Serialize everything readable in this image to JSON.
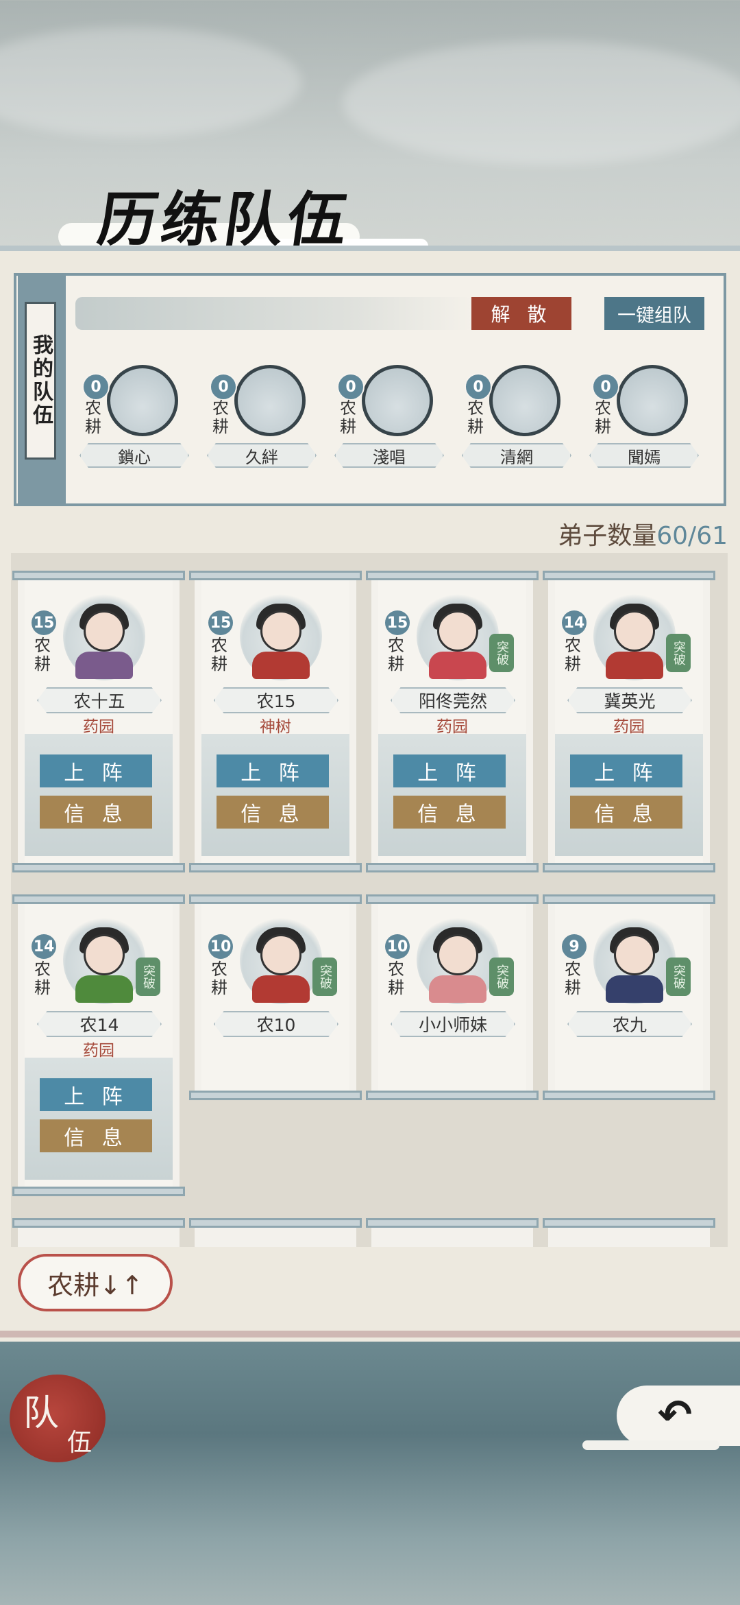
{
  "title": "历练队伍",
  "team": {
    "label": "我的队伍",
    "disband_label": "解 散",
    "auto_label": "一键组队",
    "members": [
      {
        "level": "0",
        "skill": "农耕",
        "name": "鎖心"
      },
      {
        "level": "0",
        "skill": "农耕",
        "name": "久絆"
      },
      {
        "level": "0",
        "skill": "农耕",
        "name": "淺唱"
      },
      {
        "level": "0",
        "skill": "农耕",
        "name": "清網"
      },
      {
        "level": "0",
        "skill": "农耕",
        "name": "聞嫣"
      }
    ]
  },
  "disciples": {
    "label": "弟子数量",
    "count": "60/61",
    "cards": [
      {
        "level": "15",
        "skill": "农耕",
        "name": "农十五",
        "location": "药园",
        "breakthrough": "",
        "up_label": "上 阵",
        "info_label": "信 息"
      },
      {
        "level": "15",
        "skill": "农耕",
        "name": "农15",
        "location": "神树",
        "breakthrough": "",
        "up_label": "上 阵",
        "info_label": "信 息"
      },
      {
        "level": "15",
        "skill": "农耕",
        "name": "阳佟莞然",
        "location": "药园",
        "breakthrough": "突破",
        "up_label": "上 阵",
        "info_label": "信 息"
      },
      {
        "level": "14",
        "skill": "农耕",
        "name": "冀英光",
        "location": "药园",
        "breakthrough": "突破",
        "up_label": "上 阵",
        "info_label": "信 息"
      },
      {
        "level": "14",
        "skill": "农耕",
        "name": "农14",
        "location": "药园",
        "breakthrough": "突破",
        "up_label": "上 阵",
        "info_label": "信 息"
      },
      {
        "level": "10",
        "skill": "农耕",
        "name": "农10",
        "location": "",
        "breakthrough": "突破"
      },
      {
        "level": "10",
        "skill": "农耕",
        "name": "小小师妹",
        "location": "",
        "breakthrough": "突破"
      },
      {
        "level": "9",
        "skill": "农耕",
        "name": "农九",
        "location": "",
        "breakthrough": "突破"
      }
    ]
  },
  "sort_label": "农耕↓↑",
  "nav": {
    "team_tab_char1": "队",
    "team_tab_char2": "伍",
    "back_icon": "back-arrow-icon"
  },
  "colors": {
    "accent_blue": "#4d8aa6",
    "info_brown": "#a68552",
    "disband_red": "#9e4432",
    "location_red": "#a5493a"
  }
}
